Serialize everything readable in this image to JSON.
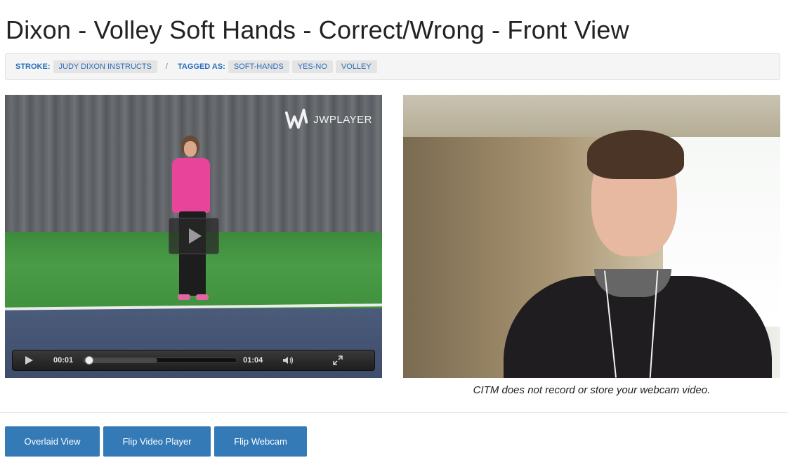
{
  "page": {
    "title": "Dixon - Volley Soft Hands - Correct/Wrong - Front View"
  },
  "tagbar": {
    "stroke_label": "STROKE:",
    "stroke_value": "JUDY DIXON INSTRUCTS",
    "separator": "/",
    "tagged_label": "TAGGED AS:",
    "tags": [
      "SOFT-HANDS",
      "YES-NO",
      "VOLLEY"
    ]
  },
  "player": {
    "brand": "JWPLAYER",
    "elapsed": "00:01",
    "duration": "01:04",
    "progress_fraction": 0.016,
    "buffer_fraction": 0.48,
    "icons": {
      "logo": "jwplayer-logo-icon",
      "big_play": "play-icon",
      "play": "play-icon",
      "volume": "volume-icon",
      "fullscreen": "fullscreen-icon"
    }
  },
  "webcam": {
    "note": "CITM does not record or store your webcam video."
  },
  "buttons": {
    "overlaid": "Overlaid View",
    "flip_video": "Flip Video Player",
    "flip_webcam": "Flip Webcam"
  },
  "colors": {
    "accent": "#337ab7",
    "tag_text": "#2a6ebb"
  }
}
